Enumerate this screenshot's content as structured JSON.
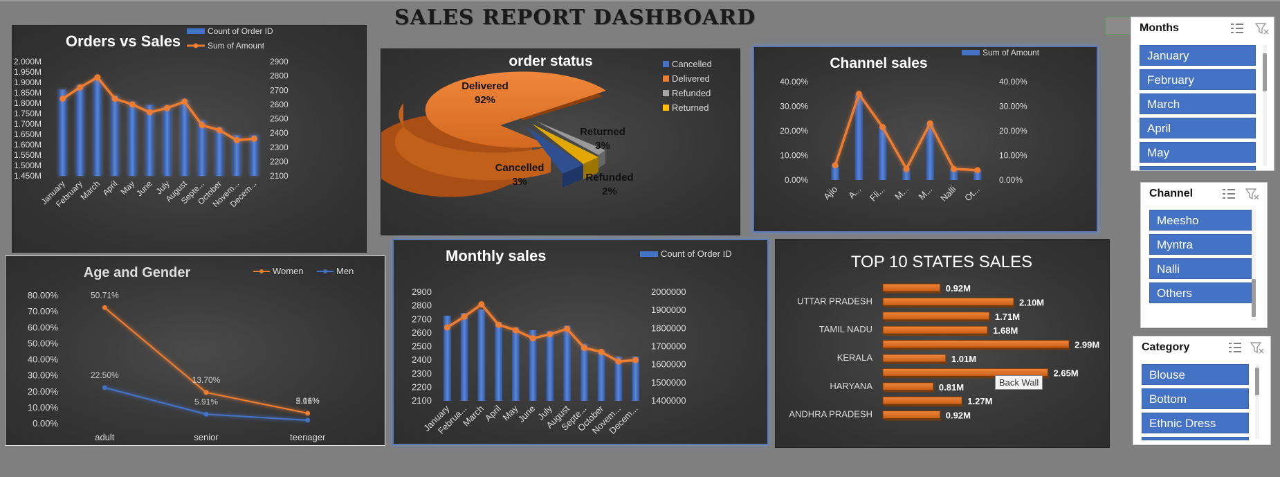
{
  "dashboard_title": "SALES REPORT DASHBOARD",
  "tooltip": "Back Wall",
  "colors": {
    "blue": "#4472c4",
    "orange": "#ed7d31",
    "panel": "#3a3a3a",
    "gray": "#a5a5a5",
    "gold": "#ffc000"
  },
  "slicers": {
    "months": {
      "title": "Months",
      "items": [
        "January",
        "February",
        "March",
        "April",
        "May"
      ]
    },
    "channel": {
      "title": "Channel",
      "items": [
        "Meesho",
        "Myntra",
        "Nalli",
        "Others"
      ]
    },
    "category": {
      "title": "Category",
      "items": [
        "Blouse",
        "Bottom",
        "Ethnic Dress"
      ]
    },
    "icons": {
      "multiselect": "multi-select-icon",
      "clear": "clear-filter-icon"
    }
  },
  "chart_data": [
    {
      "id": "orders_vs_sales",
      "type": "bar+line",
      "title": "Orders vs Sales",
      "categories": [
        "January",
        "February",
        "March",
        "April",
        "May",
        "June",
        "July",
        "August",
        "Septe...",
        "October",
        "Novem...",
        "Decem..."
      ],
      "series": [
        {
          "name": "Count of Order ID",
          "type": "bar",
          "axis": "left",
          "values": [
            1.865,
            1.885,
            1.915,
            1.835,
            1.805,
            1.79,
            1.785,
            1.815,
            1.715,
            1.68,
            1.645,
            1.645
          ]
        },
        {
          "name": "Sum of Amount",
          "type": "line",
          "axis": "right",
          "values": [
            2640,
            2720,
            2790,
            2640,
            2600,
            2545,
            2575,
            2620,
            2455,
            2420,
            2350,
            2360
          ]
        }
      ],
      "y_left": {
        "ticks": [
          "2.000M",
          "1.950M",
          "1.900M",
          "1.850M",
          "1.800M",
          "1.750M",
          "1.700M",
          "1.650M",
          "1.600M",
          "1.550M",
          "1.500M",
          "1.450M"
        ],
        "min": 1.45,
        "max": 2.0
      },
      "y_right": {
        "ticks": [
          "2900",
          "2800",
          "2700",
          "2600",
          "2500",
          "2400",
          "2300",
          "2200",
          "2100"
        ],
        "min": 2100,
        "max": 2900
      }
    },
    {
      "id": "order_status",
      "type": "pie",
      "title": "order status",
      "labels": [
        "Cancelled",
        "Delivered",
        "Refunded",
        "Returned"
      ],
      "values": [
        3,
        92,
        2,
        3
      ],
      "data_labels": [
        {
          "name": "Delivered",
          "pct": "92%"
        },
        {
          "name": "Returned",
          "pct": "3%"
        },
        {
          "name": "Cancelled",
          "pct": "3%"
        },
        {
          "name": "Refunded",
          "pct": "2%"
        }
      ]
    },
    {
      "id": "channel_sales",
      "type": "bar+line",
      "title": "Channel sales",
      "legend": "Sum of Amount",
      "categories": [
        "Ajio",
        "A...",
        "Fli...",
        "M...",
        "M...",
        "Nalli",
        "Ot..."
      ],
      "values": [
        6,
        35,
        21.5,
        4.5,
        23,
        4.5,
        4
      ],
      "y_ticks": [
        "40.00%",
        "30.00%",
        "20.00%",
        "10.00%",
        "0.00%"
      ],
      "ylim": [
        0,
        40
      ]
    },
    {
      "id": "age_gender",
      "type": "line",
      "title": "Age and Gender",
      "categories": [
        "adult",
        "senior",
        "teenager"
      ],
      "series": [
        {
          "name": "Women",
          "values": [
            72.5,
            19.5,
            6.5
          ],
          "labels": [
            "50.71%",
            "13.70%",
            "5.01%"
          ]
        },
        {
          "name": "Men",
          "values": [
            22.5,
            5.91,
            2.16
          ],
          "labels": [
            "22.50%",
            "5.91%",
            "2.16%"
          ]
        }
      ],
      "y_ticks": [
        "80.00%",
        "70.00%",
        "60.00%",
        "50.00%",
        "40.00%",
        "30.00%",
        "20.00%",
        "10.00%",
        "0.00%"
      ],
      "ylim": [
        0,
        80
      ]
    },
    {
      "id": "monthly_sales",
      "type": "bar+line",
      "title": "Monthly sales",
      "legend": "Count of Order ID",
      "categories": [
        "January",
        "Februa...",
        "March",
        "April",
        "May",
        "June",
        "July",
        "August",
        "Septe...",
        "October",
        "Novem...",
        "Decem..."
      ],
      "series": [
        {
          "name": "Count of Order ID",
          "type": "bar",
          "axis": "right",
          "values": [
            1870000,
            1885000,
            1905000,
            1835000,
            1805000,
            1790000,
            1785000,
            1815000,
            1715000,
            1680000,
            1645000,
            1645000
          ]
        },
        {
          "name": "line",
          "type": "line",
          "axis": "left",
          "values": [
            2640,
            2720,
            2810,
            2660,
            2620,
            2560,
            2590,
            2630,
            2490,
            2460,
            2390,
            2400
          ]
        }
      ],
      "y_left": {
        "ticks": [
          "2900",
          "2800",
          "2700",
          "2600",
          "2500",
          "2400",
          "2300",
          "2200",
          "2100"
        ],
        "min": 2100,
        "max": 2900
      },
      "y_right": {
        "ticks": [
          "2000000",
          "1900000",
          "1800000",
          "1700000",
          "1600000",
          "1500000",
          "1400000"
        ],
        "min": 1400000,
        "max": 2000000
      }
    },
    {
      "id": "top10_states",
      "type": "bar",
      "title": "TOP 10 STATES SALES",
      "categories": [
        "",
        "UTTAR PRADESH",
        "",
        "TAMIL NADU",
        "",
        "KERALA",
        "",
        "HARYANA",
        "",
        "ANDHRA PRADESH"
      ],
      "values": [
        0.92,
        2.1,
        1.71,
        1.68,
        2.99,
        1.01,
        2.65,
        0.81,
        1.27,
        0.92
      ],
      "labels": [
        "0.92M",
        "2.10M",
        "1.71M",
        "1.68M",
        "2.99M",
        "1.01M",
        "2.65M",
        "0.81M",
        "1.27M",
        "0.92M"
      ]
    }
  ]
}
